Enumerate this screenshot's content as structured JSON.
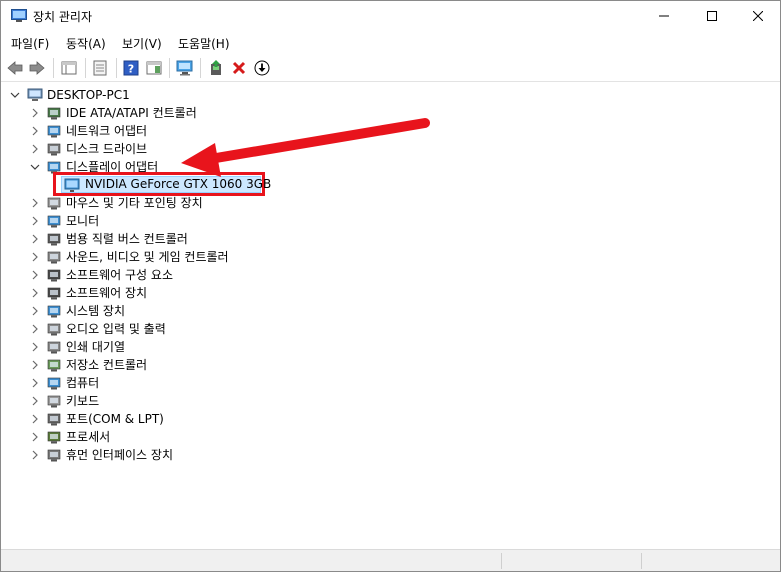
{
  "window": {
    "title": "장치 관리자"
  },
  "menu": {
    "items": [
      "파일(F)",
      "동작(A)",
      "보기(V)",
      "도움말(H)"
    ]
  },
  "tree": {
    "root": "DESKTOP-PC1",
    "categories": [
      "IDE ATA/ATAPI 컨트롤러",
      "네트워크 어댑터",
      "디스크 드라이브",
      "디스플레이 어댑터",
      "마우스 및 기타 포인팅 장치",
      "모니터",
      "범용 직렬 버스 컨트롤러",
      "사운드, 비디오 및 게임 컨트롤러",
      "소프트웨어 구성 요소",
      "소프트웨어 장치",
      "시스템 장치",
      "오디오 입력 및 출력",
      "인쇄 대기열",
      "저장소 컨트롤러",
      "컴퓨터",
      "키보드",
      "포트(COM & LPT)",
      "프로세서",
      "휴먼 인터페이스 장치"
    ],
    "display_child": "NVIDIA GeForce GTX 1060 3GB"
  },
  "colors": {
    "annotation_red": "#e8141c",
    "selection_bg": "#cce8ff"
  }
}
